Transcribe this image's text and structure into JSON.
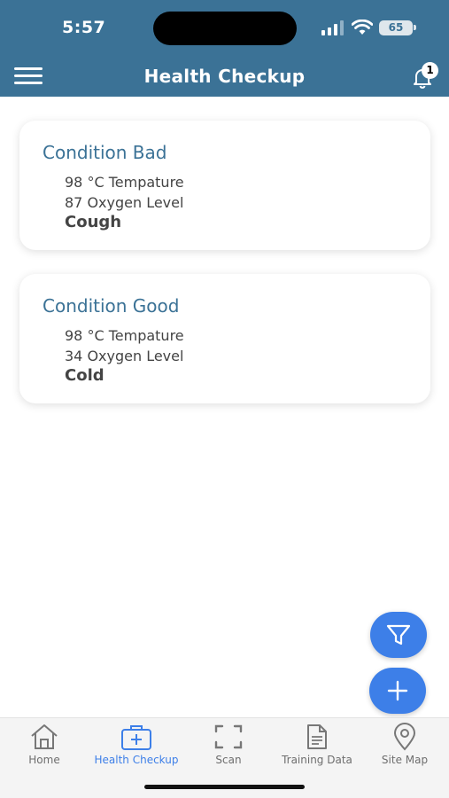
{
  "status_bar": {
    "time": "5:57",
    "battery": "65"
  },
  "header": {
    "title": "Health Checkup",
    "notification_count": "1"
  },
  "cards": [
    {
      "condition": "Condition Bad",
      "temperature": "98 °C Tempature",
      "oxygen": "87 Oxygen Level",
      "symptom": "Cough"
    },
    {
      "condition": "Condition Good",
      "temperature": "98 °C Tempature",
      "oxygen": "34 Oxygen Level",
      "symptom": "Cold"
    }
  ],
  "bottom_nav": [
    {
      "label": "Home",
      "icon": "home-icon"
    },
    {
      "label": "Health Checkup",
      "icon": "medical-kit-icon",
      "active": true
    },
    {
      "label": "Scan",
      "icon": "scan-icon"
    },
    {
      "label": "Training Data",
      "icon": "document-icon"
    },
    {
      "label": "Site Map",
      "icon": "location-pin-icon"
    }
  ],
  "colors": {
    "header": "#3b7296",
    "accent": "#3d7fe8",
    "card_title": "#3b7296"
  }
}
